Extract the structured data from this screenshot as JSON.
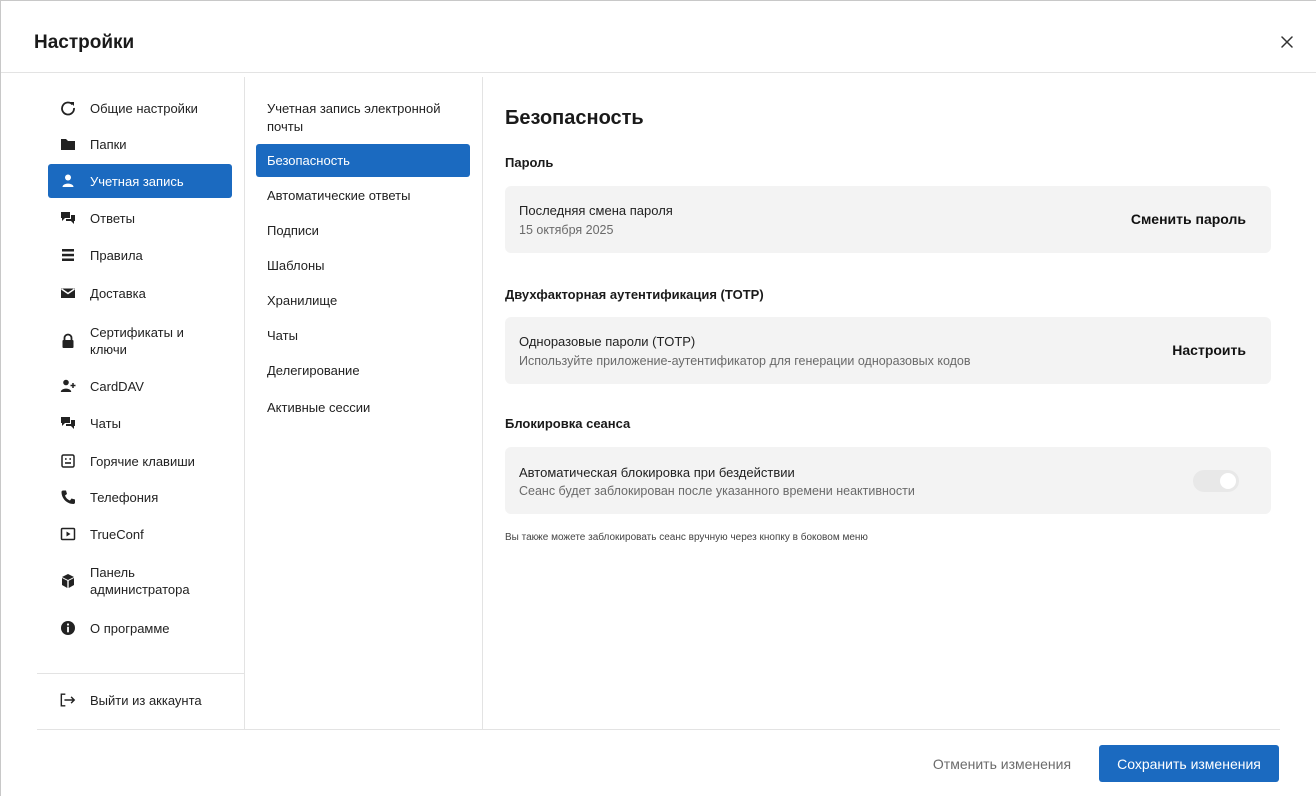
{
  "header": {
    "title": "Настройки",
    "close_icon": "close-icon"
  },
  "sidebar": {
    "items": [
      {
        "label": "Общие настройки",
        "icon": "refresh-icon"
      },
      {
        "label": "Папки",
        "icon": "folder-icon"
      },
      {
        "label": "Учетная запись",
        "icon": "user-icon",
        "active": true
      },
      {
        "label": "Ответы",
        "icon": "chat-icon"
      },
      {
        "label": "Правила",
        "icon": "rules-icon"
      },
      {
        "label": "Доставка",
        "icon": "envelope-icon"
      },
      {
        "label": "Сертификаты и ключи",
        "icon": "lock-icon"
      },
      {
        "label": "CardDAV",
        "icon": "add-user-icon"
      },
      {
        "label": "Чаты",
        "icon": "chats-icon"
      },
      {
        "label": "Горячие клавиши",
        "icon": "keyboard-icon"
      },
      {
        "label": "Телефония",
        "icon": "phone-icon"
      },
      {
        "label": "TrueConf",
        "icon": "video-icon"
      },
      {
        "label": "Панель администратора",
        "icon": "admin-icon"
      },
      {
        "label": "О программе",
        "icon": "info-icon"
      }
    ],
    "logout_label": "Выйти из аккаунта"
  },
  "subnav": {
    "items": [
      {
        "label": "Учетная запись электронной почты"
      },
      {
        "label": "Безопасность",
        "active": true
      },
      {
        "label": "Автоматические ответы"
      },
      {
        "label": "Подписи"
      },
      {
        "label": "Шаблоны"
      },
      {
        "label": "Хранилище"
      },
      {
        "label": "Чаты"
      },
      {
        "label": "Делегирование"
      },
      {
        "label": "Активные сессии"
      }
    ]
  },
  "content": {
    "title": "Безопасность",
    "password": {
      "heading": "Пароль",
      "card_title": "Последняя смена пароля",
      "card_sub": "15 октября 2025",
      "action": "Сменить пароль"
    },
    "totp": {
      "heading": "Двухфакторная аутентификация (TOTP)",
      "card_title": "Одноразовые пароли (TOTP)",
      "card_sub": "Используйте приложение-аутентификатор для генерации одноразовых кодов",
      "action": "Настроить"
    },
    "lock": {
      "heading": "Блокировка сеанса",
      "card_title": "Автоматическая блокировка при бездействии",
      "card_sub": "Сеанс будет заблокирован после указанного времени неактивности",
      "toggle_on": false
    },
    "hint": "Вы также можете заблокировать сеанс вручную через кнопку в боковом меню"
  },
  "footer": {
    "cancel_label": "Отменить изменения",
    "save_label": "Сохранить изменения"
  },
  "colors": {
    "accent": "#1b6ac0",
    "card_bg": "#f3f3f3"
  }
}
